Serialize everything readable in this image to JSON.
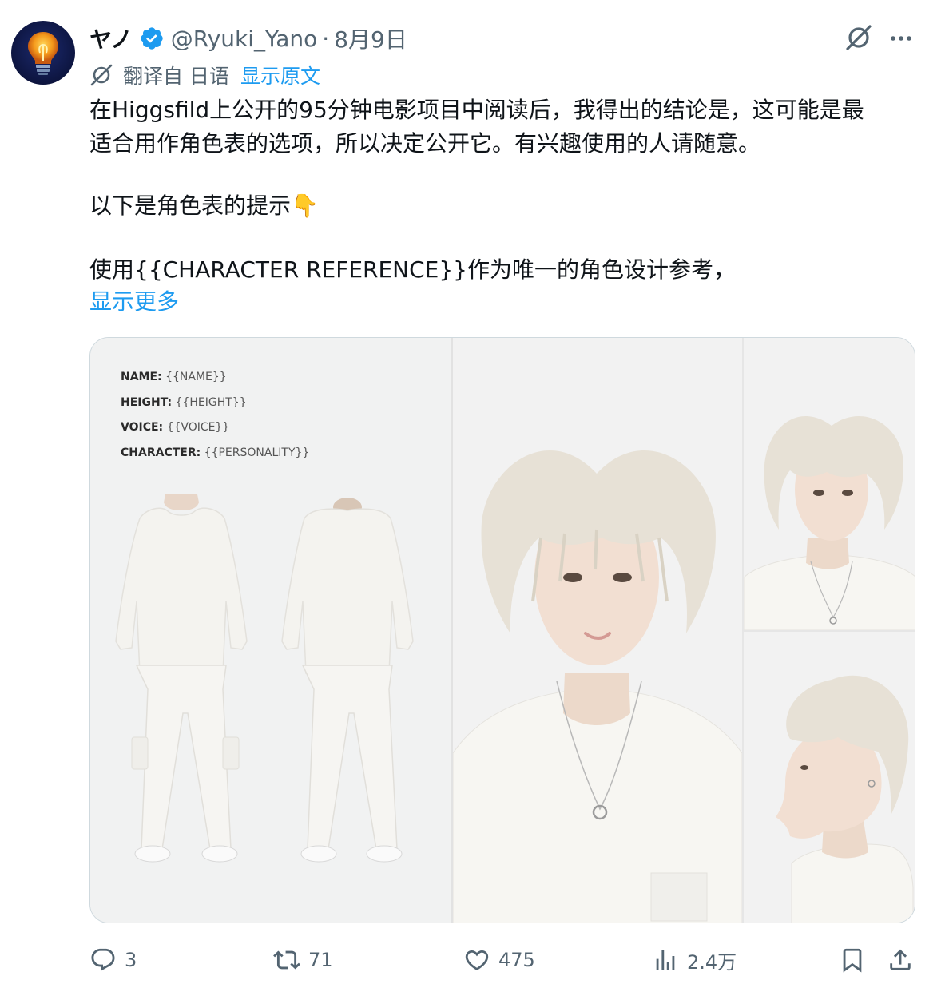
{
  "tweet": {
    "display_name": "ヤノ",
    "handle": "@Ryuki_Yano",
    "separator": "·",
    "date": "8月9日",
    "translation": {
      "label": "翻译自 日语",
      "show_original": "显示原文"
    },
    "text_lines": [
      "在Higgsfild上公开的95分钟电影项目中阅读后，我得出的结论是，这可能是最",
      "适合用作角色表的选项，所以决定公开它。有兴趣使用的人请随意。",
      "以下是角色表的提示👇",
      "使用{{CHARACTER REFERENCE}}作为唯一的角色设计参考，"
    ],
    "show_more": "显示更多"
  },
  "media": {
    "sheet": {
      "name_label": "NAME:",
      "name_value": "{{NAME}}",
      "height_label": "HEIGHT:",
      "height_value": "{{HEIGHT}}",
      "voice_label": "VOICE:",
      "voice_value": "{{VOICE}}",
      "character_label": "CHARACTER:",
      "character_value": "{{PERSONALITY}}"
    }
  },
  "actions": {
    "replies": "3",
    "retweets": "71",
    "likes": "475",
    "views": "2.4万"
  },
  "colors": {
    "accent": "#1d9bf0",
    "secondary_text": "#536471",
    "verified": "#1d9bf0"
  },
  "icons": [
    "lightbulb-avatar",
    "verified-badge-icon",
    "grok-icon",
    "more-icon",
    "translate-icon",
    "reply-icon",
    "retweet-icon",
    "like-icon",
    "views-icon",
    "bookmark-icon",
    "share-icon"
  ]
}
